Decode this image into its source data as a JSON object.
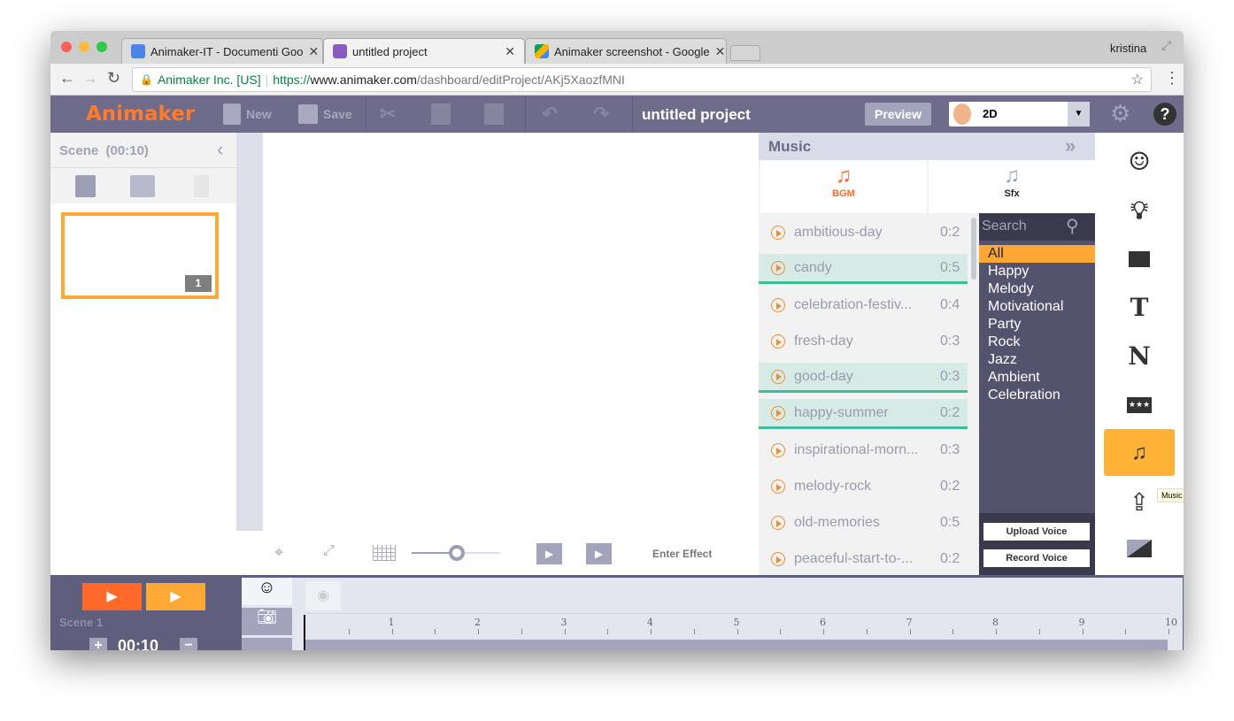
{
  "browser": {
    "tabs": [
      {
        "title": "Animaker-IT - Documenti Goo",
        "icon": "docs-icon"
      },
      {
        "title": "untitled project",
        "icon": "animaker-icon"
      },
      {
        "title": "Animaker screenshot - Google",
        "icon": "drive-icon"
      }
    ],
    "user": "kristina",
    "secure_label": "Animaker Inc. [US]",
    "url_scheme": "https://",
    "url_host": "www.animaker.com",
    "url_path": "/dashboard/editProject/AKj5XaozfMNI"
  },
  "toolbar": {
    "logo": "Animaker",
    "new": "New",
    "save": "Save",
    "project_title": "untitled project",
    "preview": "Preview",
    "mode": "2D"
  },
  "scene_panel": {
    "title": "Scene",
    "duration": "(00:10)",
    "scene_number": "1"
  },
  "canvas_toolbar": {
    "enter_effect": "Enter Effect",
    "zoom_fraction": 0.5
  },
  "music": {
    "title": "Music",
    "tabs": [
      {
        "label": "BGM",
        "active": true
      },
      {
        "label": "Sfx",
        "active": false
      }
    ],
    "tracks": [
      {
        "name": "ambitious-day",
        "duration": "0:2",
        "highlighted": false
      },
      {
        "name": "candy",
        "duration": "0:5",
        "highlighted": true
      },
      {
        "name": "celebration-festiv...",
        "duration": "0:4",
        "highlighted": false
      },
      {
        "name": "fresh-day",
        "duration": "0:3",
        "highlighted": false
      },
      {
        "name": "good-day",
        "duration": "0:3",
        "highlighted": true
      },
      {
        "name": "happy-summer",
        "duration": "0:2",
        "highlighted": true
      },
      {
        "name": "inspirational-morn...",
        "duration": "0:3",
        "highlighted": false
      },
      {
        "name": "melody-rock",
        "duration": "0:2",
        "highlighted": false
      },
      {
        "name": "old-memories",
        "duration": "0:5",
        "highlighted": false
      },
      {
        "name": "peaceful-start-to-...",
        "duration": "0:2",
        "highlighted": false
      }
    ],
    "search_placeholder": "Search",
    "categories": [
      "All",
      "Happy",
      "Melody",
      "Motivational",
      "Party",
      "Rock",
      "Jazz",
      "Ambient",
      "Celebration"
    ],
    "selected_category": "All",
    "upload_voice": "Upload Voice",
    "record_voice": "Record Voice"
  },
  "right_bar": {
    "items": [
      "character-icon",
      "bulb-icon",
      "image-icon",
      "text-icon",
      "n-icon",
      "rating-icon",
      "music-icon",
      "upload-icon",
      "background-icon"
    ],
    "active": "music-icon",
    "tooltip": "Music"
  },
  "timeline": {
    "scene_label": "Scene 1",
    "duration": "00:10",
    "ticks": [
      "1",
      "2",
      "3",
      "4",
      "5",
      "6",
      "7",
      "8",
      "9",
      "10"
    ]
  },
  "colors": {
    "accent": "#ffa836",
    "orange": "#ff6a2a",
    "toolbar": "#6e6c8a",
    "highlight": "#3cbf98"
  }
}
